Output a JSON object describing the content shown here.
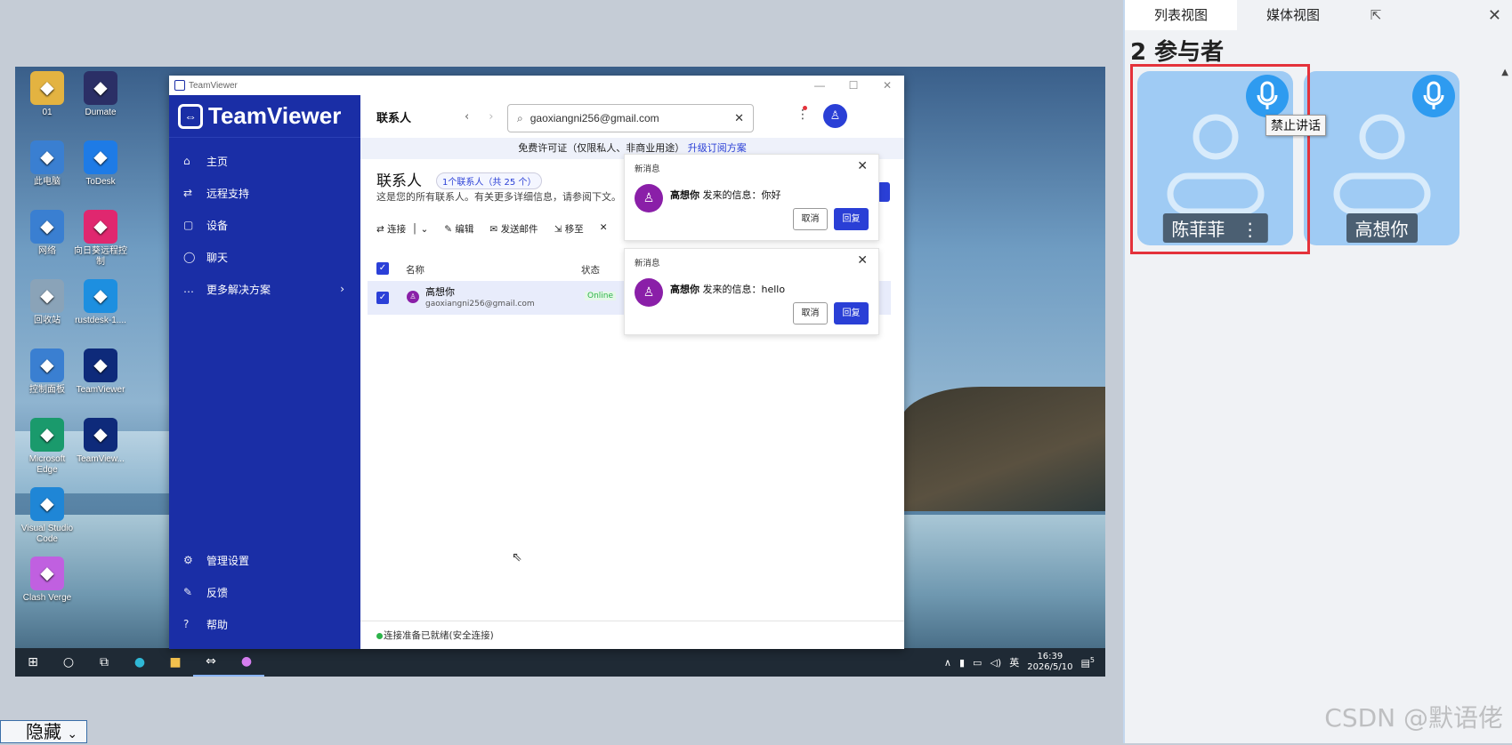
{
  "desktop_icons": [
    {
      "label": "01",
      "icon": "folder-person-icon",
      "color": "#e3b341"
    },
    {
      "label": "Dumate",
      "icon": "dumate-icon",
      "color": "#2b2f66"
    },
    {
      "label": "此电脑",
      "icon": "computer-icon",
      "color": "#3a7fd1"
    },
    {
      "label": "ToDesk",
      "icon": "todesk-icon",
      "color": "#1e7be6"
    },
    {
      "label": "网络",
      "icon": "network-icon",
      "color": "#3a7fd1"
    },
    {
      "label": "向日葵远程控制",
      "icon": "sunlogin-icon",
      "color": "#e0276f"
    },
    {
      "label": "回收站",
      "icon": "recycle-bin-icon",
      "color": "#8aa3b8"
    },
    {
      "label": "rustdesk-1....",
      "icon": "rustdesk-icon",
      "color": "#1d8fe0"
    },
    {
      "label": "控制面板",
      "icon": "control-panel-icon",
      "color": "#3a7fd1"
    },
    {
      "label": "TeamViewer",
      "icon": "teamviewer-icon",
      "color": "#0e2a7a"
    },
    {
      "label": "Microsoft Edge",
      "icon": "edge-icon",
      "color": "#1a9a6c"
    },
    {
      "label": "TeamView...",
      "icon": "teamviewer-icon",
      "color": "#0e2a7a"
    },
    {
      "label": "Visual Studio Code",
      "icon": "vscode-icon",
      "color": "#1f86d6"
    },
    {
      "label": "Clash Verge",
      "icon": "clash-verge-icon",
      "color": "#c060e0"
    }
  ],
  "teamviewer": {
    "window_title": "TeamViewer",
    "logo": "TeamViewer",
    "nav": [
      {
        "label": "主页",
        "icon": "home-icon",
        "glyph": "⌂"
      },
      {
        "label": "远程支持",
        "icon": "remote-support-icon",
        "glyph": "⇄"
      },
      {
        "label": "设备",
        "icon": "devices-icon",
        "glyph": "▢"
      },
      {
        "label": "聊天",
        "icon": "chat-icon",
        "glyph": "◯"
      },
      {
        "label": "更多解决方案",
        "icon": "more-icon",
        "glyph": "…"
      }
    ],
    "bottom_nav": [
      {
        "label": "管理设置",
        "icon": "settings-icon",
        "glyph": "⚙"
      },
      {
        "label": "反馈",
        "icon": "feedback-icon",
        "glyph": "✎"
      },
      {
        "label": "帮助",
        "icon": "help-icon",
        "glyph": "?"
      }
    ],
    "page_title": "联系人",
    "search_value": "gaoxiangni256@gmail.com",
    "banner_text": "免费许可证（仅限私人、非商业用途）",
    "banner_link": "升级订阅方案",
    "contacts_heading": "联系人",
    "contacts_badge": "1个联系人（共 25 个）",
    "contacts_sub": "这是您的所有联系人。有关更多详细信息，请参阅下文。",
    "toolbar": {
      "connect": "连接",
      "edit": "编辑",
      "send_email": "发送邮件",
      "move": "移至"
    },
    "columns": {
      "name": "名称",
      "status": "状态"
    },
    "contact": {
      "name": "高想你",
      "email": "gaoxiangni256@gmail.com",
      "status": "Online"
    },
    "status_bar": "连接准备已就绪(安全连接)",
    "notifications": [
      {
        "title": "新消息",
        "sender": "高想你",
        "text": " 发来的信息：你好",
        "cancel": "取消",
        "reply": "回复"
      },
      {
        "title": "新消息",
        "sender": "高想你",
        "text": " 发来的信息：hello",
        "cancel": "取消",
        "reply": "回复"
      }
    ]
  },
  "taskbar": {
    "ime": "英",
    "time": "16:39",
    "date": "2026/5/10",
    "notif_count": "5"
  },
  "panel": {
    "tabs": [
      "列表视图",
      "媒体视图"
    ],
    "title": "2 参与者",
    "participants": [
      {
        "name": "陈菲菲",
        "mic": "on"
      },
      {
        "name": "高想你",
        "mic": "on"
      }
    ],
    "tooltip": "禁止讲话",
    "watermark": "CSDN @默语佬"
  },
  "hide_button": "隐藏"
}
